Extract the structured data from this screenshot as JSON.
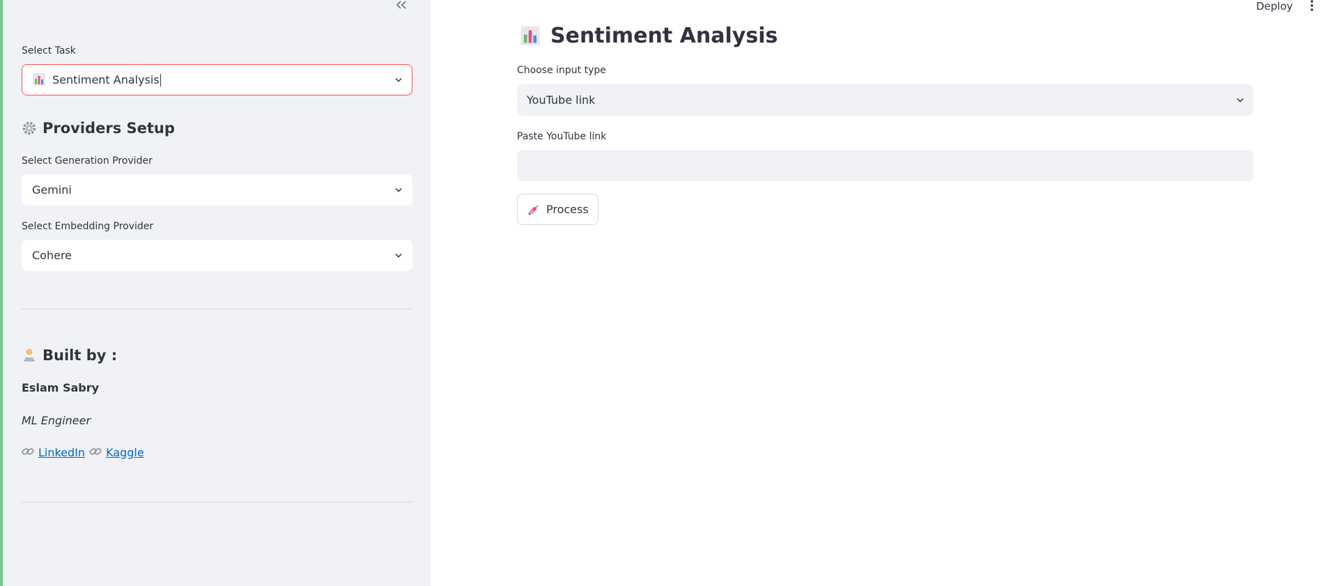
{
  "sidebar": {
    "collapse_icon": "double-chevron-left-icon",
    "task_label": "Select Task",
    "task_value": "Sentiment Analysis",
    "task_icon": "bar-chart-icon",
    "providers_heading": "Providers Setup",
    "providers_icon": "gear-icon",
    "generation_label": "Select Generation Provider",
    "generation_value": "Gemini",
    "embedding_label": "Select Embedding Provider",
    "embedding_value": "Cohere",
    "built_by_heading": "Built by :",
    "built_by_icon": "technologist-icon",
    "author_name": "Eslam Sabry",
    "author_role": "ML Engineer",
    "links": [
      {
        "label": "LinkedIn",
        "icon": "link-icon"
      },
      {
        "label": "Kaggle",
        "icon": "link-icon"
      }
    ]
  },
  "header": {
    "deploy_label": "Deploy",
    "menu_icon": "vertical-dots-icon"
  },
  "main": {
    "title": "Sentiment Analysis",
    "title_icon": "bar-chart-icon",
    "input_type_label": "Choose input type",
    "input_type_value": "YouTube link",
    "link_label": "Paste YouTube link",
    "link_value": "",
    "link_placeholder": "",
    "process_label": "Process",
    "process_icon": "syringe-icon"
  },
  "colors": {
    "sidebar_bg": "#f0f2f6",
    "focus_border": "#ff4b4b",
    "link": "#0068c9",
    "window_edge": "#7dc58f"
  }
}
